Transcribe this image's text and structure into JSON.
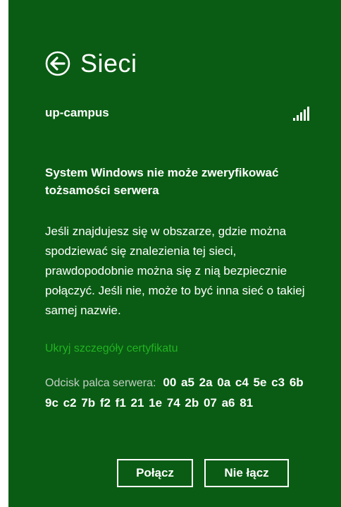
{
  "header": {
    "title": "Sieci",
    "back_icon": "back-arrow-circle-icon"
  },
  "network": {
    "name": "up-campus",
    "signal_icon": "signal-strength-icon"
  },
  "warning": {
    "title": "System Windows nie może zweryfikować tożsamości serwera",
    "body": "Jeśli znajdujesz się w obszarze, gdzie można spodziewać się znalezienia tej sieci, prawdopodobnie można się z nią bezpiecznie połączyć. Jeśli nie, może to być inna sieć o takiej samej nazwie."
  },
  "certificate": {
    "toggle_label": "Ukryj szczegóły certyfikatu",
    "fingerprint_label": "Odcisk palca serwera:",
    "fingerprint_value": "00 a5 2a 0a c4 5e c3 6b 9c c2 7b f2 f1 21 1e 74 2b 07 a6 81"
  },
  "actions": {
    "connect_label": "Połącz",
    "disconnect_label": "Nie łącz"
  },
  "colors": {
    "panel_background": "#0a5c14",
    "text": "#ffffff",
    "link": "#21b321",
    "muted_label": "#c3cfc5"
  }
}
